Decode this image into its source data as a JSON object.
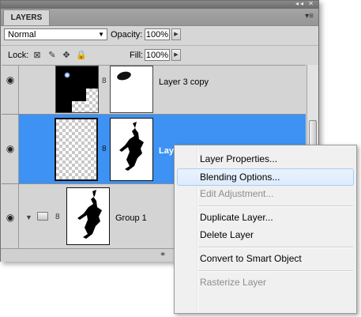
{
  "panel": {
    "tab_label": "LAYERS",
    "window_controls": "◂◂ ✕",
    "menu_icon": "▾≡",
    "blend_mode": "Normal",
    "opacity_label": "Opacity:",
    "opacity_value": "100%",
    "lock_label": "Lock:",
    "fill_label": "Fill:",
    "fill_value": "100%"
  },
  "layers": [
    {
      "name": "Layer 3 copy",
      "visible": true,
      "selected": false
    },
    {
      "name": "Laye",
      "visible": true,
      "selected": true
    },
    {
      "name": "Group 1",
      "visible": true,
      "selected": false,
      "type": "group"
    }
  ],
  "context_menu": {
    "items": [
      {
        "label": "Layer Properties...",
        "enabled": true,
        "highlighted": false
      },
      {
        "label": "Blending Options...",
        "enabled": true,
        "highlighted": true
      },
      {
        "label": "Edit Adjustment...",
        "enabled": false,
        "highlighted": false
      },
      {
        "label": "Duplicate Layer...",
        "enabled": true,
        "highlighted": false
      },
      {
        "label": "Delete Layer",
        "enabled": true,
        "highlighted": false
      },
      {
        "label": "Convert to Smart Object",
        "enabled": true,
        "highlighted": false
      },
      {
        "label": "Rasterize Layer",
        "enabled": false,
        "highlighted": false
      }
    ]
  },
  "colors": {
    "selected_row": "#3d92f4",
    "panel_bg": "#d6d6d6",
    "menu_highlight": "#dcebfc"
  },
  "icons": {
    "eye": "eye-icon",
    "link": "chain-link-icon",
    "folder": "folder-icon",
    "expand": "triangle-expand-icon",
    "lock_transparent": "lock-transparent-pixels-icon",
    "lock_image": "lock-image-pixels-icon",
    "lock_position": "lock-position-icon",
    "lock_all": "lock-all-icon"
  }
}
